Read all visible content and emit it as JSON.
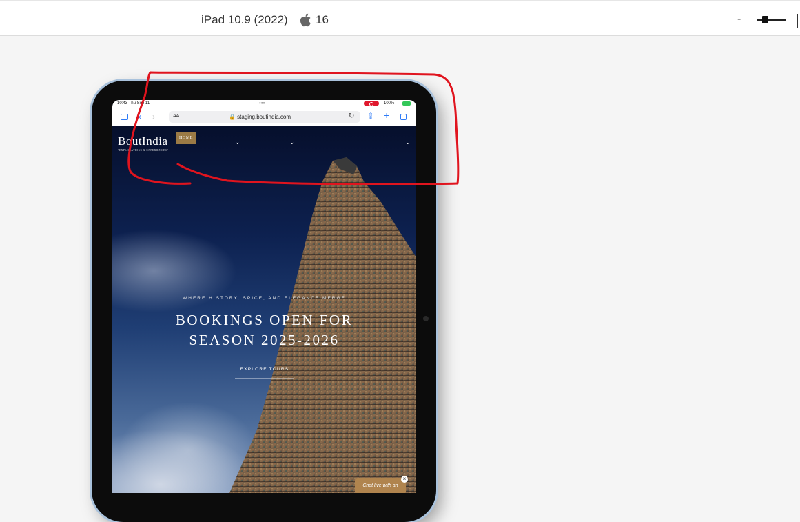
{
  "toolbar": {
    "device_name": "iPad 10.9 (2022)",
    "os_icon": "apple-icon",
    "os_version": "16",
    "zoom_minus": "-",
    "zoom_level": 0.25
  },
  "ipad": {
    "status_bar": {
      "time": "10:43  Thu Sep 11",
      "dots": "•••",
      "battery": "100%"
    },
    "safari": {
      "aa_label": "AA",
      "url": "🔒 staging.boutindia.com",
      "reload_icon": "reload-icon",
      "back_icon": "chevron-left-icon",
      "forward_icon": "chevron-right-icon",
      "share_icon": "share-icon",
      "add_icon": "plus-icon",
      "tabs_icon": "tabs-icon",
      "sidebar_icon": "sidebar-icon"
    },
    "site": {
      "logo_text": "BoutIndia",
      "logo_tagline": "\"EXPLORATIONS & EXPERIENCES\"",
      "nav_home": "HOME",
      "nav_chevron": "⌄",
      "hero_subtitle": "WHERE HISTORY, SPICE, AND ELEGANCE MERGE",
      "hero_title_line1": "BOOKINGS OPEN FOR",
      "hero_title_line2": "SEASON 2025-2026",
      "cta_label": "EXPLORE TOURS",
      "chat_label": "Chat live with an",
      "chat_close": "×"
    }
  },
  "colors": {
    "annotation": "#e0141e",
    "home_button": "#9b7a45",
    "chat_widget": "#b0844e",
    "safari_accent": "#2f7bf6"
  }
}
